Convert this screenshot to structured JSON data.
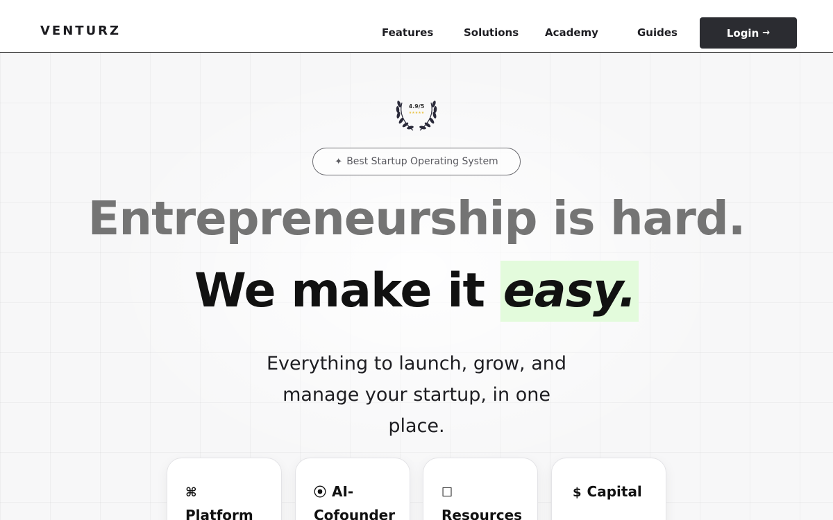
{
  "header": {
    "logo": "VENTURZ",
    "nav": {
      "features": "Features",
      "solutions": "Solutions",
      "academy": "Academy",
      "guides": "Guides"
    },
    "login_label": "Login",
    "login_arrow": "→"
  },
  "hero": {
    "rating": "4.9/5",
    "rating_stars": "★★★★★",
    "badge_icon": "✦",
    "badge_text": "Best Startup Operating System",
    "headline_1": "Entrepreneurship is hard.",
    "headline_2_main": "We make it ",
    "headline_2_emph": "easy.",
    "subtext": "Everything to launch, grow, and manage your startup, in one place."
  },
  "cards": [
    {
      "icon": "⌘",
      "icon_name": "command-icon",
      "title_a": "Platform",
      "title_b": ""
    },
    {
      "icon": "⦿",
      "icon_name": "target-icon",
      "title_a": "AI-",
      "title_b": "Cofounder"
    },
    {
      "icon": "☐",
      "icon_name": "square-icon",
      "title_a": "Resources",
      "title_b": ""
    },
    {
      "icon": "$",
      "icon_name": "dollar-icon",
      "title_a": "Capital",
      "title_b": ""
    }
  ],
  "colors": {
    "accent_highlight": "#e3fbdc",
    "button_dark": "#2b2c31",
    "headline_grey": "#747474",
    "award_gold": "#e8c34a"
  }
}
